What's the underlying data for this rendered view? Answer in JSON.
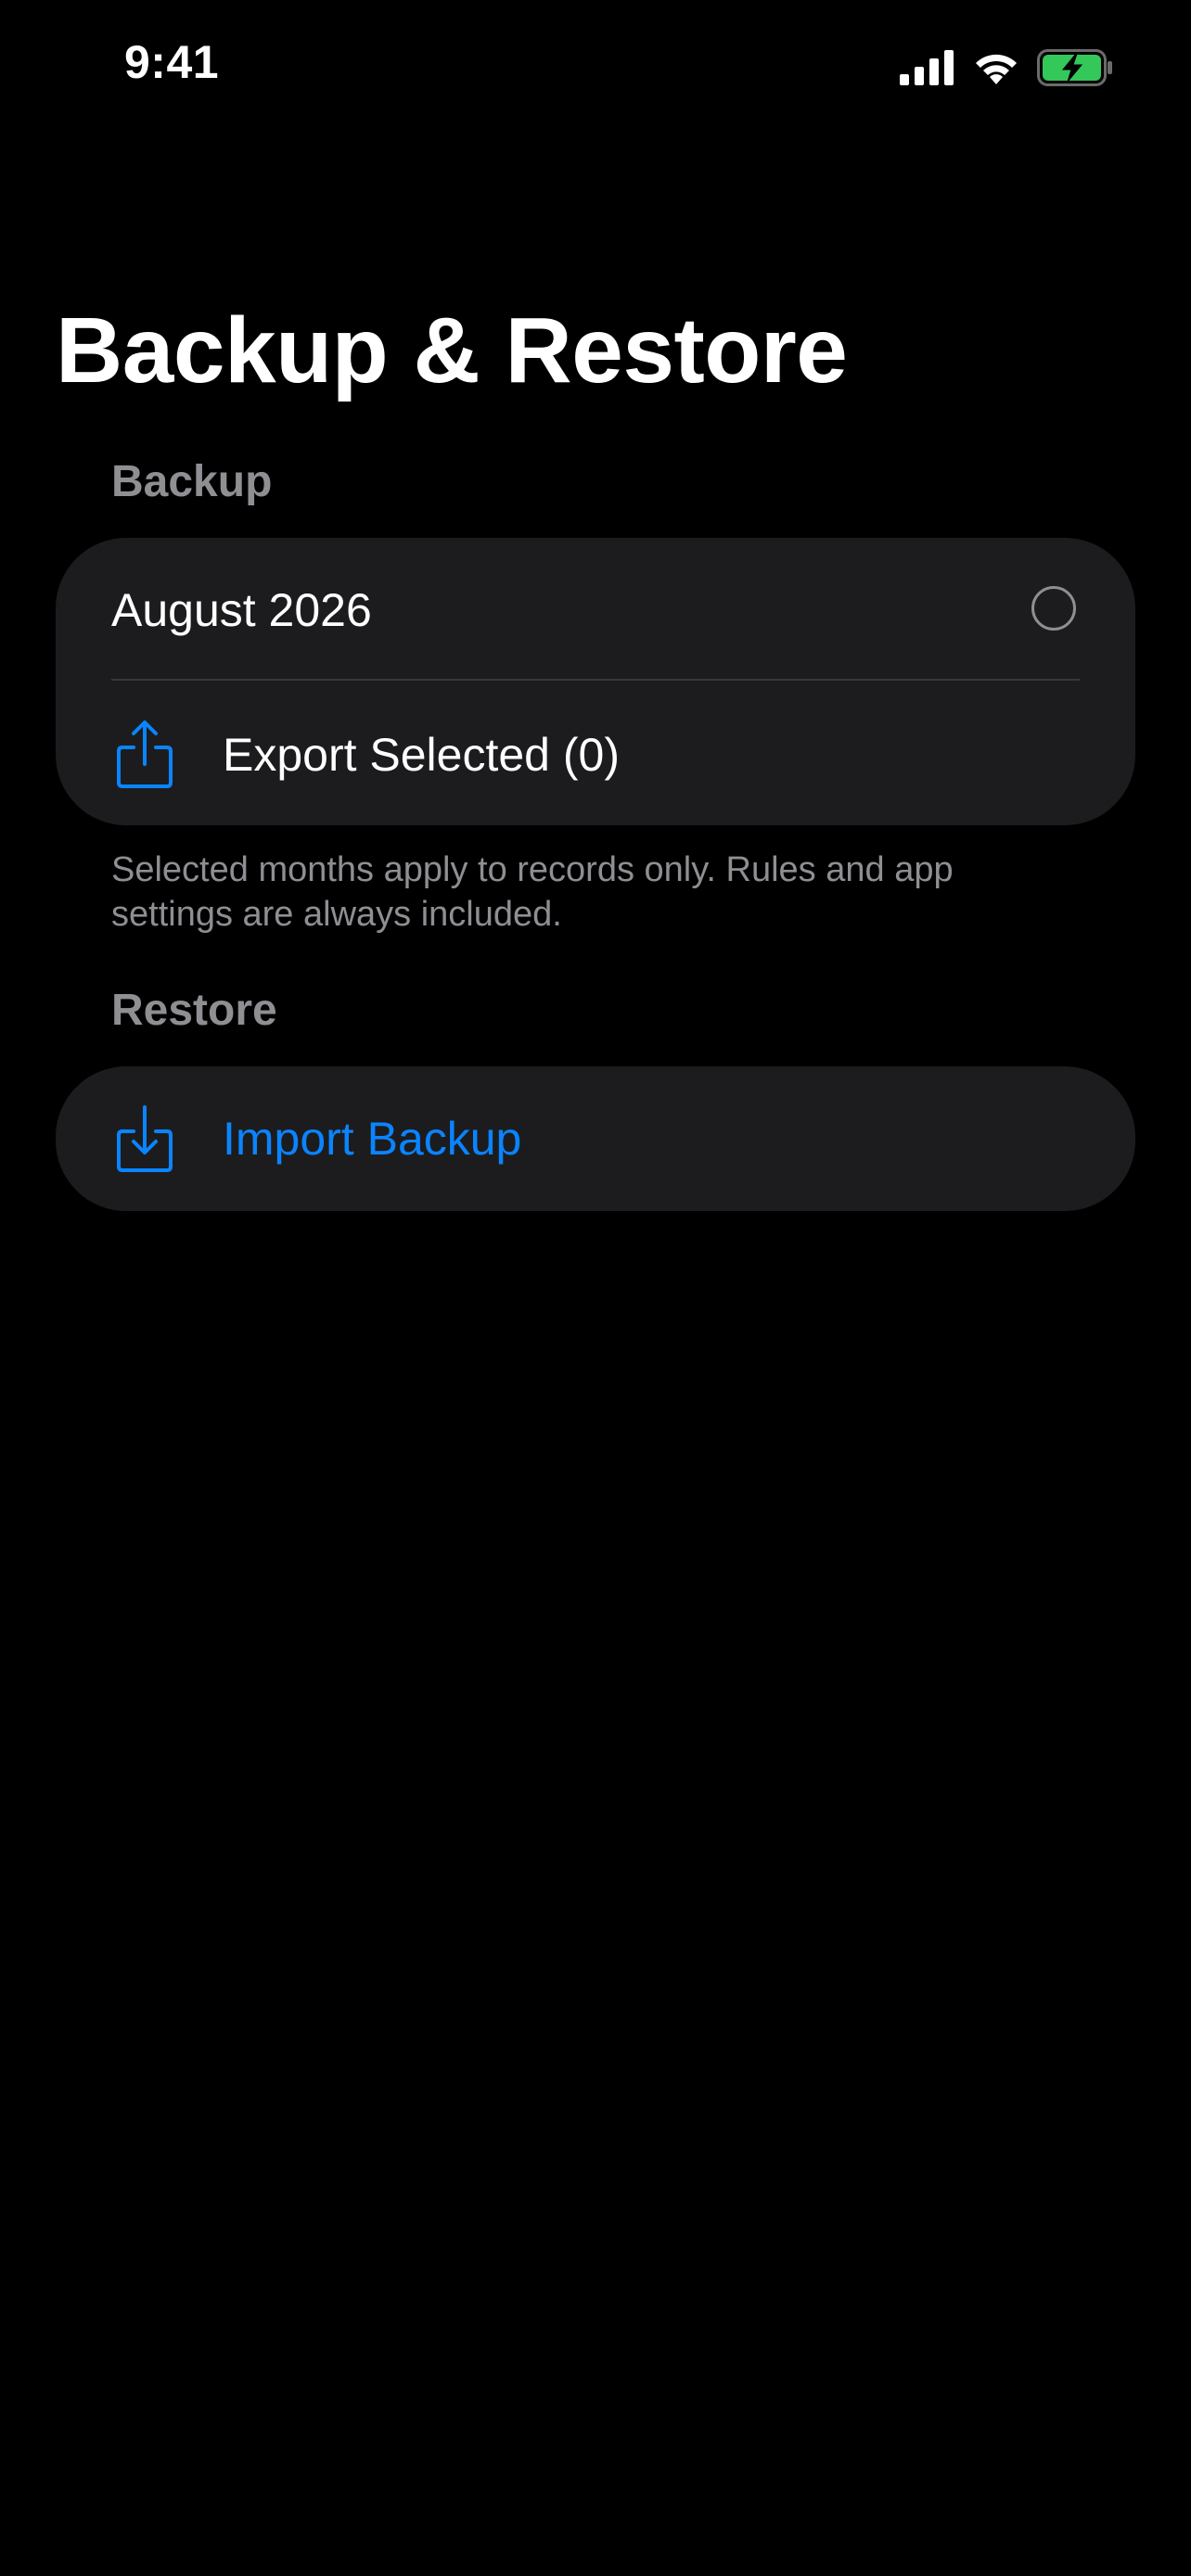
{
  "status_bar": {
    "time": "9:41",
    "icons": [
      "cellular-signal-icon",
      "wifi-icon",
      "battery-charging-icon"
    ],
    "battery_color": "#34c759"
  },
  "page": {
    "title": "Backup & Restore"
  },
  "backup_section": {
    "header": "Backup",
    "month_item": {
      "label": "August 2026",
      "selected": false
    },
    "export": {
      "label": "Export Selected (0)",
      "icon": "share-icon"
    },
    "footer": "Selected months apply to records only. Rules and app settings are always included."
  },
  "restore_section": {
    "header": "Restore",
    "import": {
      "label": "Import Backup",
      "icon": "import-icon"
    }
  },
  "colors": {
    "background": "#000000",
    "card": "#1c1c1e",
    "accent": "#0a84ff",
    "secondary_text": "#8e8e93",
    "separator": "#38383a"
  }
}
